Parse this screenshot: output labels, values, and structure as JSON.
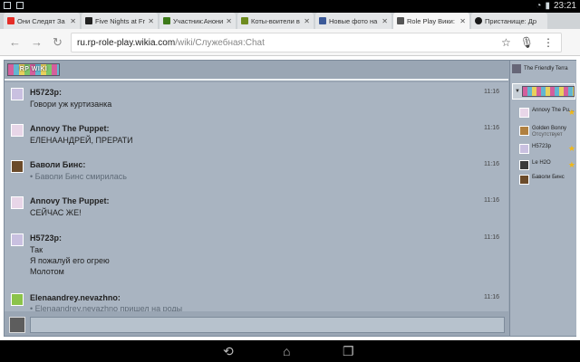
{
  "status_bar": {
    "time": "23:21"
  },
  "tabs": [
    {
      "title": "Они Следят За Т",
      "favicon_color": "#e52d27"
    },
    {
      "title": "Five Nights at Fre",
      "favicon_color": "#222222"
    },
    {
      "title": "Участник:Аноним",
      "favicon_color": "#3d7a19"
    },
    {
      "title": "Коты-воители в",
      "favicon_color": "#6e8b1e"
    },
    {
      "title": "Новые фото на",
      "favicon_color": "#3b5998"
    },
    {
      "title": "Role Play Вики:",
      "favicon_color": "#555555",
      "active": true
    },
    {
      "title": "Пристанище: Др",
      "favicon_color": "#1a1a1a"
    }
  ],
  "address_bar": {
    "host": "ru.rp-role-play.wikia.com",
    "path": "/wiki/Служебная:Chat"
  },
  "chat": {
    "wordmark": "RP WIKI",
    "messages": [
      {
        "user": "H5723p",
        "time": "11:16",
        "lines": [
          "Говори уж куртизанка"
        ],
        "avatar_color": "#c9c0e0"
      },
      {
        "user": "Annovy The Puppet",
        "time": "11:16",
        "lines": [
          "ЕЛЕНААНДРЕЙ, ПРЕРАТИ"
        ],
        "avatar_color": "#e8d6e8"
      },
      {
        "user": "Баволи Бинс",
        "time": "11:16",
        "note": "• Баволи Бинс смирилась",
        "avatar_color": "#6b4b2a"
      },
      {
        "user": "Annovy The Puppet",
        "time": "11:16",
        "lines": [
          "СЕЙЧАС ЖЕ!"
        ],
        "avatar_color": "#e8d6e8"
      },
      {
        "user": "H5723p",
        "time": "11:16",
        "lines": [
          "Так",
          "Я пожалуй его огрею",
          "Молотом"
        ],
        "avatar_color": "#c9c0e0"
      },
      {
        "user": "Elenaandrey.nevazhno",
        "time": "11:16",
        "note": "• Elenaandrey.nevazhno пришел на роды",
        "avatar_color": "#8bc34a"
      }
    ],
    "composer_placeholder": ""
  },
  "sidebar": {
    "room_name": "The Friendly Terra",
    "users": [
      {
        "name": "Annovy The Pu...",
        "star": true,
        "avatar_color": "#e8d6e8"
      },
      {
        "name": "Golden Bonny",
        "status": "Отсутствует",
        "star": false,
        "avatar_color": "#b08040"
      },
      {
        "name": "H5723p",
        "star": true,
        "avatar_color": "#c9c0e0"
      },
      {
        "name": "Le H2O",
        "star": true,
        "avatar_color": "#3a3a3a"
      },
      {
        "name": "Баволи Бинс",
        "star": false,
        "avatar_color": "#6b4b2a"
      }
    ]
  }
}
